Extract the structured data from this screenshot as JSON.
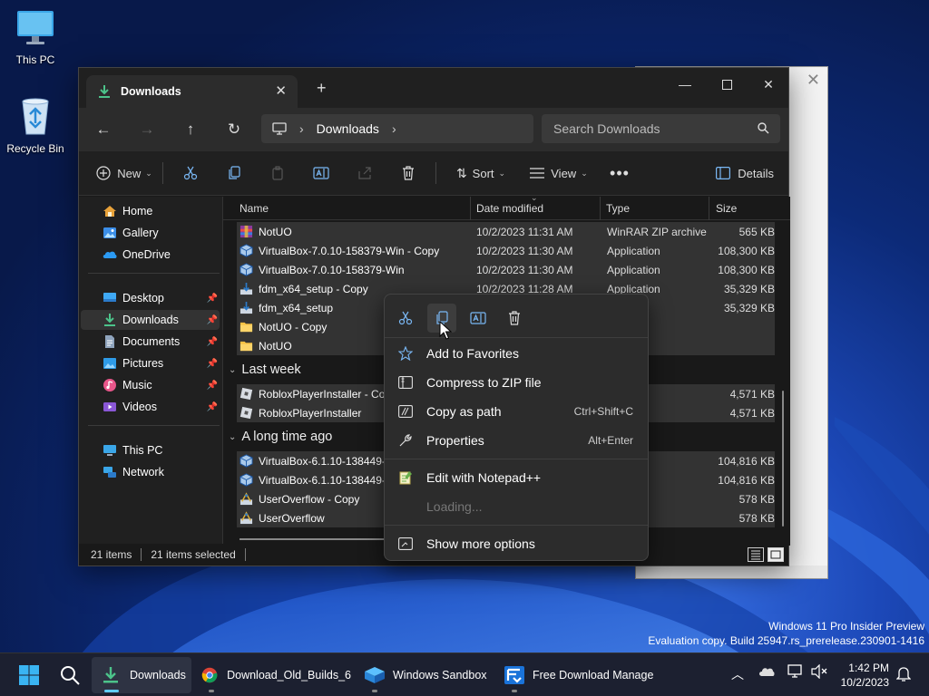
{
  "desktop": {
    "icons": [
      {
        "label": "This PC"
      },
      {
        "label": "Recycle Bin"
      }
    ],
    "watermark": {
      "line1": "Windows 11 Pro Insider Preview",
      "line2": "Evaluation copy. Build 25947.rs_prerelease.230901-1416"
    }
  },
  "explorer": {
    "tab_title": "Downloads",
    "address": {
      "segment": "Downloads"
    },
    "search_placeholder": "Search Downloads",
    "command_bar": {
      "new_label": "New",
      "sort_label": "Sort",
      "view_label": "View",
      "details_label": "Details"
    },
    "nav_pane": {
      "items": [
        {
          "label": "Home",
          "icon": "home-icon"
        },
        {
          "label": "Gallery",
          "icon": "gallery-icon"
        },
        {
          "label": "OneDrive",
          "icon": "cloud-icon"
        },
        {
          "label": "Desktop",
          "icon": "desktop-folder-icon",
          "pinned": true
        },
        {
          "label": "Downloads",
          "icon": "download-icon",
          "pinned": true,
          "selected": true
        },
        {
          "label": "Documents",
          "icon": "documents-icon",
          "pinned": true
        },
        {
          "label": "Pictures",
          "icon": "pictures-icon",
          "pinned": true
        },
        {
          "label": "Music",
          "icon": "music-icon",
          "pinned": true
        },
        {
          "label": "Videos",
          "icon": "videos-icon",
          "pinned": true
        },
        {
          "label": "This PC",
          "icon": "this-pc-icon"
        },
        {
          "label": "Network",
          "icon": "network-icon"
        }
      ]
    },
    "columns": {
      "name": "Name",
      "date": "Date modified",
      "type": "Type",
      "size": "Size"
    },
    "groups": [
      {
        "label": "",
        "rows": [
          {
            "name": "NotUO",
            "date": "10/2/2023 11:31 AM",
            "type": "WinRAR ZIP archive",
            "size": "565 KB",
            "icon": "zip-icon"
          },
          {
            "name": "VirtualBox-7.0.10-158379-Win - Copy",
            "date": "10/2/2023 11:30 AM",
            "type": "Application",
            "size": "108,300 KB",
            "icon": "virtualbox-icon"
          },
          {
            "name": "VirtualBox-7.0.10-158379-Win",
            "date": "10/2/2023 11:30 AM",
            "type": "Application",
            "size": "108,300 KB",
            "icon": "virtualbox-icon"
          },
          {
            "name": "fdm_x64_setup - Copy",
            "date": "10/2/2023 11:28 AM",
            "type": "Application",
            "size": "35,329 KB",
            "icon": "installer-icon"
          },
          {
            "name": "fdm_x64_setup",
            "date": "",
            "type": "on",
            "size": "35,329 KB",
            "icon": "installer-icon"
          },
          {
            "name": "NotUO - Copy",
            "date": "",
            "type": "er",
            "size": "",
            "icon": "folder-icon"
          },
          {
            "name": "NotUO",
            "date": "",
            "type": "er",
            "size": "",
            "icon": "folder-icon"
          }
        ]
      },
      {
        "label": "Last week",
        "rows": [
          {
            "name": "RobloxPlayerInstaller - Cop",
            "date": "",
            "type": "on",
            "size": "4,571 KB",
            "icon": "roblox-icon"
          },
          {
            "name": "RobloxPlayerInstaller",
            "date": "",
            "type": "on",
            "size": "4,571 KB",
            "icon": "roblox-icon"
          }
        ]
      },
      {
        "label": "A long time ago",
        "rows": [
          {
            "name": "VirtualBox-6.1.10-138449-V",
            "date": "",
            "type": "on",
            "size": "104,816 KB",
            "icon": "virtualbox-icon"
          },
          {
            "name": "VirtualBox-6.1.10-138449-V",
            "date": "",
            "type": "on",
            "size": "104,816 KB",
            "icon": "virtualbox-icon"
          },
          {
            "name": "UserOverflow - Copy",
            "date": "",
            "type": "on",
            "size": "578 KB",
            "icon": "installer-icon"
          },
          {
            "name": "UserOverflow",
            "date": "",
            "type": "on",
            "size": "578 KB",
            "icon": "installer-icon"
          }
        ]
      }
    ],
    "status": {
      "count": "21 items",
      "selected": "21 items selected"
    }
  },
  "context_menu": {
    "quick_actions": [
      "cut-icon",
      "copy-icon",
      "rename-icon",
      "delete-icon"
    ],
    "items": [
      {
        "label": "Add to Favorites",
        "icon": "star-icon",
        "shortcut": ""
      },
      {
        "label": "Compress to ZIP file",
        "icon": "zip-folder-icon",
        "shortcut": ""
      },
      {
        "label": "Copy as path",
        "icon": "path-icon",
        "shortcut": "Ctrl+Shift+C"
      },
      {
        "label": "Properties",
        "icon": "wrench-icon",
        "shortcut": "Alt+Enter"
      },
      {
        "label": "Edit with Notepad++",
        "icon": "notepadpp-icon",
        "shortcut": ""
      },
      {
        "label": "Loading...",
        "icon": "",
        "shortcut": "",
        "disabled": true
      },
      {
        "label": "Show more options",
        "icon": "more-options-icon",
        "shortcut": ""
      }
    ]
  },
  "taskbar": {
    "apps": [
      {
        "label": "Downloads",
        "icon": "file-explorer-icon",
        "active": true
      },
      {
        "label": "Download_Old_Builds_6",
        "icon": "chrome-icon"
      },
      {
        "label": "Windows Sandbox",
        "icon": "sandbox-icon"
      },
      {
        "label": "Free Download Manage",
        "icon": "fdm-icon"
      }
    ],
    "clock": {
      "time": "1:42 PM",
      "date": "10/2/2023"
    }
  },
  "colors": {
    "accent": "#60cdff",
    "folder": "#f6c244",
    "selection": "#333333"
  }
}
